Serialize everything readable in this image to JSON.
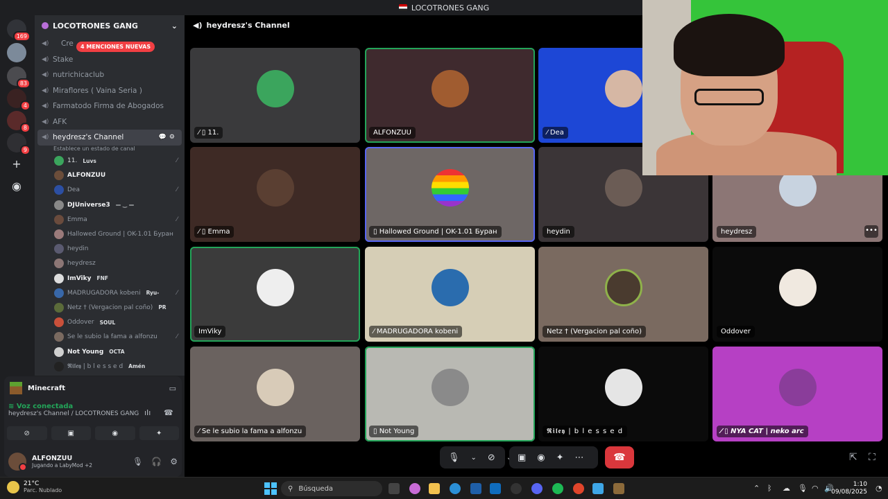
{
  "window": {
    "title": "LOCOTRONES GANG"
  },
  "rail": {
    "badges": [
      "169",
      "83",
      "4",
      "8",
      "9"
    ]
  },
  "sidebar": {
    "server_name": "LOCOTRONES GANG",
    "mentions_banner": "4 MENCIONES NUEVAS",
    "channels": [
      {
        "label": "Cre"
      },
      {
        "label": "Stake"
      },
      {
        "label": "nutrichicaclub"
      },
      {
        "label": "Miraflores ( Vaina Seria )"
      },
      {
        "label": "Farmatodo Firma de Abogados"
      },
      {
        "label": "AFK"
      }
    ],
    "active_channel": {
      "label": "heydresz's Channel",
      "status": "Establece un estado de canal"
    },
    "members": [
      {
        "name": "11.",
        "tag": "Luvs"
      },
      {
        "name": "ALFONZUU",
        "tag": ""
      },
      {
        "name": "Dea",
        "tag": ""
      },
      {
        "name": "DJUniverse3",
        "tag": "— ‿ —"
      },
      {
        "name": "Emma",
        "tag": ""
      },
      {
        "name": "Hallowed Ground | OK-1.01 Буран",
        "tag": ""
      },
      {
        "name": "heydin",
        "tag": ""
      },
      {
        "name": "heydresz",
        "tag": ""
      },
      {
        "name": "ImViky",
        "tag": "FNF"
      },
      {
        "name": "MADRUGADORA kobeni",
        "tag": "Ryu-"
      },
      {
        "name": "Netz † (Vergacion pal coño)",
        "tag": "PR"
      },
      {
        "name": "Oddover",
        "tag": "SOUL"
      },
      {
        "name": "Se le subio la fama a alfonzu",
        "tag": ""
      },
      {
        "name": "Not Young",
        "tag": "OCTA"
      },
      {
        "name": "𝕽𝖎𝖑𝖊𝖞 | b l e s s e d",
        "tag": "Amén"
      }
    ]
  },
  "panel": {
    "activity": "Minecraft",
    "voice_status": "Voz conectada",
    "voice_channel": "heydresz's Channel / LOCOTRONES GANG",
    "user_name": "ALFONZUU",
    "user_status": "Jugando a LabyMod +2"
  },
  "call": {
    "channel_title": "heydresz's Channel",
    "tiles": [
      {
        "name": "11.",
        "color": "#3a3a3c"
      },
      {
        "name": "ALFONZUU",
        "color": "#3f2a2e"
      },
      {
        "name": "Dea",
        "color": "#1d47d6"
      },
      {
        "name": "Emma",
        "color": "#3e2a25"
      },
      {
        "name": "Hallowed Ground | OK-1.01 Буран",
        "color": "#6e6765"
      },
      {
        "name": "heydin",
        "color": "#3b3537"
      },
      {
        "name": "heydresz",
        "color": "#8c7675"
      },
      {
        "name": "ImViky",
        "color": "#3b3b3b"
      },
      {
        "name": "MADRUGADORA kobeni",
        "color": "#d6ceb6"
      },
      {
        "name": "Netz † (Vergacion pal coño)",
        "color": "#7a6a60"
      },
      {
        "name": "Oddover",
        "color": "#0b0b0b"
      },
      {
        "name": "Se le subio la fama a alfonzu",
        "color": "#6a625f"
      },
      {
        "name": "Not Young",
        "color": "#b9b9b3"
      },
      {
        "name": "𝕽𝖎𝖑𝖊𝖞 | b l e s s e d",
        "color": "#0b0b0b"
      },
      {
        "name": "NYA CAT | neko arc",
        "color": "#b640c4"
      }
    ]
  },
  "taskbar": {
    "temperature": "21°C",
    "weather": "Parc. Nublado",
    "search_placeholder": "Búsqueda",
    "time": "1:10",
    "date": "09/08/2025"
  }
}
